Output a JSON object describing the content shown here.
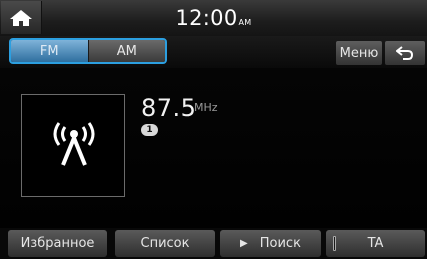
{
  "status_bar": {
    "time": "12:00",
    "ampm": "AM"
  },
  "band": {
    "options": [
      "FM",
      "AM"
    ],
    "selected": "FM"
  },
  "toolbar": {
    "menu_label": "Меню"
  },
  "station": {
    "frequency": "87.5",
    "unit": "MHz",
    "preset": "1"
  },
  "softkeys": {
    "favorites": "Избранное",
    "list": "Список",
    "search": "Поиск",
    "ta": "TA"
  },
  "colors": {
    "accent": "#2c9fe0",
    "active_band": "#5b95c2"
  },
  "icons": {
    "home": "home-icon",
    "back": "back-arrow-icon",
    "radio": "radio-antenna-icon",
    "play": "play-icon"
  }
}
